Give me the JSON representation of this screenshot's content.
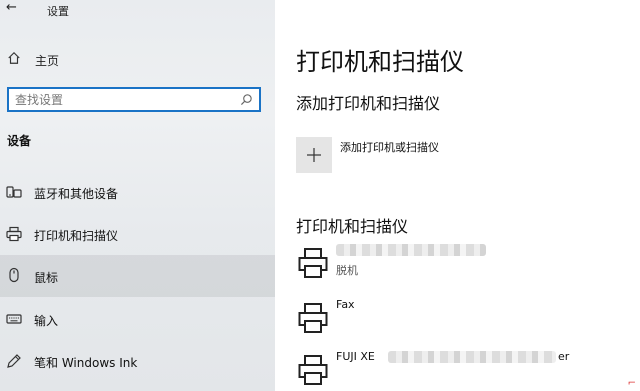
{
  "window": {
    "title": "设置"
  },
  "sidebar": {
    "home_label": "主页",
    "search_placeholder": "查找设置",
    "section_title": "设备",
    "items": [
      {
        "label": "蓝牙和其他设备",
        "icon": "bluetooth-devices-icon"
      },
      {
        "label": "打印机和扫描仪",
        "icon": "printer-icon"
      },
      {
        "label": "鼠标",
        "icon": "mouse-icon",
        "selected": true
      },
      {
        "label": "输入",
        "icon": "keyboard-icon"
      },
      {
        "label": "笔和 Windows Ink",
        "icon": "pen-icon"
      }
    ]
  },
  "main": {
    "title": "打印机和扫描仪",
    "add_section_title": "添加打印机和扫描仪",
    "add_button_label": "添加打印机或扫描仪",
    "list_section_title": "打印机和扫描仪",
    "printers": [
      {
        "name": "",
        "status": "脱机"
      },
      {
        "name": "Fax",
        "status": ""
      },
      {
        "name": "FUJI XE",
        "name_suffix": "er",
        "status": ""
      }
    ]
  },
  "colors": {
    "accent": "#1a73c6",
    "sidebar_bg": "#eceef0",
    "selected_bg": "#e2e4e6"
  }
}
